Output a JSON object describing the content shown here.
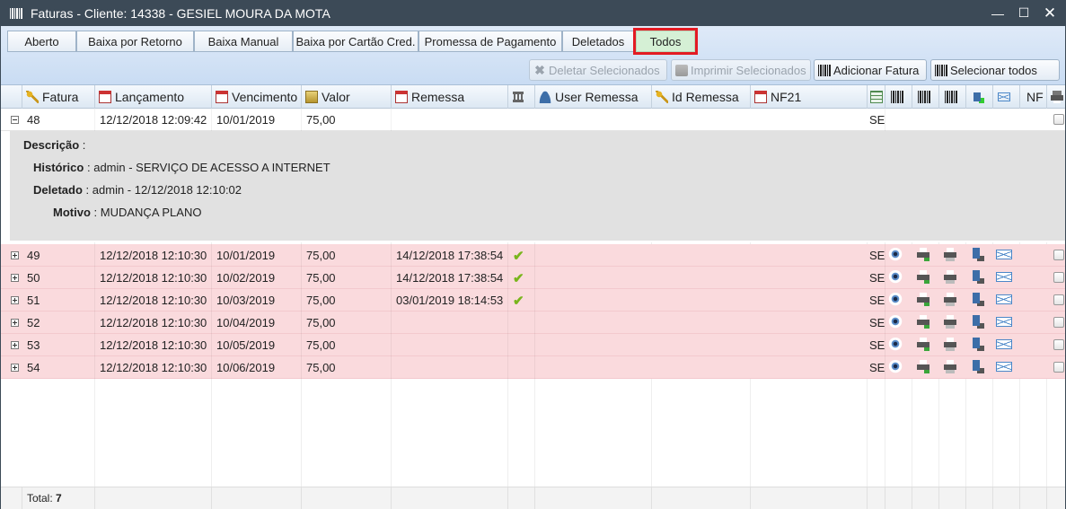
{
  "window": {
    "title": "Faturas - Cliente: 14338 - GESIEL MOURA DA MOTA",
    "controls": {
      "minimize": "—",
      "maximize": "☐",
      "close": "✕"
    }
  },
  "tabs": [
    {
      "label": "Aberto"
    },
    {
      "label": "Baixa por Retorno"
    },
    {
      "label": "Baixa Manual"
    },
    {
      "label": "Baixa por Cartão Cred."
    },
    {
      "label": "Promessa de Pagamento"
    },
    {
      "label": "Deletados"
    },
    {
      "label": "Todos",
      "active": true
    }
  ],
  "actions": {
    "delete_selected": "Deletar Selecionados",
    "print_selected": "Imprimir Selecionados",
    "add_invoice": "Adicionar Fatura",
    "select_all": "Selecionar todos"
  },
  "columns": {
    "fatura": "Fatura",
    "lancamento": "Lançamento",
    "vencimento": "Vencimento",
    "valor": "Valor",
    "remessa": "Remessa",
    "user_remessa": "User Remessa",
    "id_remessa": "Id Remessa",
    "nf21": "NF21",
    "nf": "NF"
  },
  "expanded_row": {
    "fatura": "48",
    "lancamento": "12/12/2018 12:09:42",
    "vencimento": "10/01/2019",
    "valor": "75,00",
    "tipo": "SE",
    "descricao_label": "Descrição",
    "descricao_value": "",
    "historico_label": "Histórico",
    "historico_value": "admin - SERVIÇO DE ACESSO A INTERNET",
    "deletado_label": "Deletado",
    "deletado_value": "admin - 12/12/2018 12:10:02",
    "motivo_label": "Motivo",
    "motivo_value": "MUDANÇA PLANO",
    "separator": ":"
  },
  "rows": [
    {
      "fatura": "49",
      "lancamento": "12/12/2018 12:10:30",
      "vencimento": "10/01/2019",
      "valor": "75,00",
      "remessa": "14/12/2018 17:38:54",
      "remessa_ok": "✔",
      "tipo": "SE"
    },
    {
      "fatura": "50",
      "lancamento": "12/12/2018 12:10:30",
      "vencimento": "10/02/2019",
      "valor": "75,00",
      "remessa": "14/12/2018 17:38:54",
      "remessa_ok": "✔",
      "tipo": "SE"
    },
    {
      "fatura": "51",
      "lancamento": "12/12/2018 12:10:30",
      "vencimento": "10/03/2019",
      "valor": "75,00",
      "remessa": "03/01/2019 18:14:53",
      "remessa_ok": "✔",
      "tipo": "SE"
    },
    {
      "fatura": "52",
      "lancamento": "12/12/2018 12:10:30",
      "vencimento": "10/04/2019",
      "valor": "75,00",
      "remessa": "",
      "remessa_ok": "",
      "tipo": "SE"
    },
    {
      "fatura": "53",
      "lancamento": "12/12/2018 12:10:30",
      "vencimento": "10/05/2019",
      "valor": "75,00",
      "remessa": "",
      "remessa_ok": "",
      "tipo": "SE"
    },
    {
      "fatura": "54",
      "lancamento": "12/12/2018 12:10:30",
      "vencimento": "10/06/2019",
      "valor": "75,00",
      "remessa": "",
      "remessa_ok": "",
      "tipo": "SE"
    }
  ],
  "footer": {
    "total_label": "Total:",
    "total_value": "7"
  },
  "colors": {
    "titlebar": "#3c4a57",
    "row_deleted": "#fadadd",
    "active_tab_outline": "#e31b23"
  }
}
